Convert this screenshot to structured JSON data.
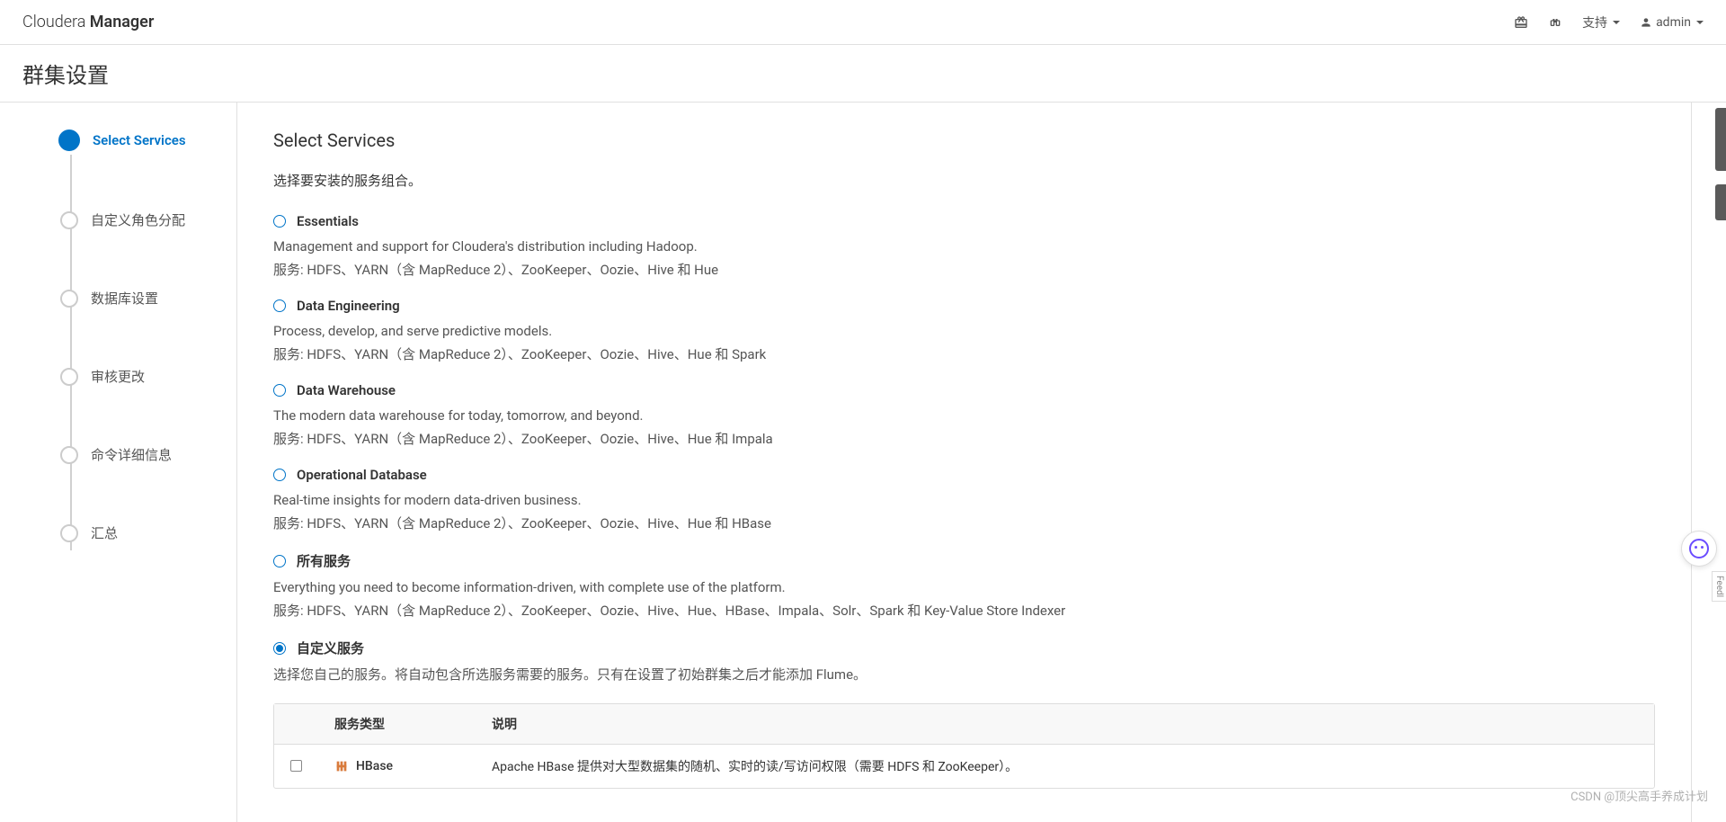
{
  "brand": {
    "light": "Cloudera ",
    "bold": "Manager"
  },
  "topbar": {
    "support": "支持",
    "user": "admin"
  },
  "pageTitle": "群集设置",
  "steps": [
    {
      "label": "Select Services",
      "active": true
    },
    {
      "label": "自定义角色分配",
      "active": false
    },
    {
      "label": "数据库设置",
      "active": false
    },
    {
      "label": "审核更改",
      "active": false
    },
    {
      "label": "命令详细信息",
      "active": false
    },
    {
      "label": "汇总",
      "active": false
    }
  ],
  "content": {
    "title": "Select Services",
    "desc": "选择要安装的服务组合。"
  },
  "options": [
    {
      "key": "essentials",
      "title": "Essentials",
      "desc": "Management and support for Cloudera's distribution including Hadoop.",
      "services": "服务: HDFS、YARN（含 MapReduce 2）、ZooKeeper、Oozie、Hive 和 Hue",
      "checked": false
    },
    {
      "key": "data-engineering",
      "title": "Data Engineering",
      "desc": "Process, develop, and serve predictive models.",
      "services": "服务: HDFS、YARN（含 MapReduce 2）、ZooKeeper、Oozie、Hive、Hue 和 Spark",
      "checked": false
    },
    {
      "key": "data-warehouse",
      "title": "Data Warehouse",
      "desc": "The modern data warehouse for today, tomorrow, and beyond.",
      "services": "服务: HDFS、YARN（含 MapReduce 2）、ZooKeeper、Oozie、Hive、Hue 和 Impala",
      "checked": false
    },
    {
      "key": "operational-database",
      "title": "Operational Database",
      "desc": "Real-time insights for modern data-driven business.",
      "services": "服务: HDFS、YARN（含 MapReduce 2）、ZooKeeper、Oozie、Hive、Hue 和 HBase",
      "checked": false
    },
    {
      "key": "all-services",
      "title": "所有服务",
      "desc": "Everything you need to become information-driven, with complete use of the platform.",
      "services": "服务: HDFS、YARN（含 MapReduce 2）、ZooKeeper、Oozie、Hive、Hue、HBase、Impala、Solr、Spark 和 Key-Value Store Indexer",
      "checked": false
    },
    {
      "key": "custom-services",
      "title": "自定义服务",
      "desc": "选择您自己的服务。将自动包含所选服务需要的服务。只有在设置了初始群集之后才能添加 Flume。",
      "services": "",
      "checked": true
    }
  ],
  "table": {
    "headers": {
      "type": "服务类型",
      "desc": "说明"
    },
    "rows": [
      {
        "name": "HBase",
        "desc": "Apache HBase 提供对大型数据集的随机、实时的读/写访问权限（需要 HDFS 和 ZooKeeper）。"
      }
    ]
  },
  "watermark": "CSDN @顶尖高手养成计划",
  "feedTab": "Feedl"
}
